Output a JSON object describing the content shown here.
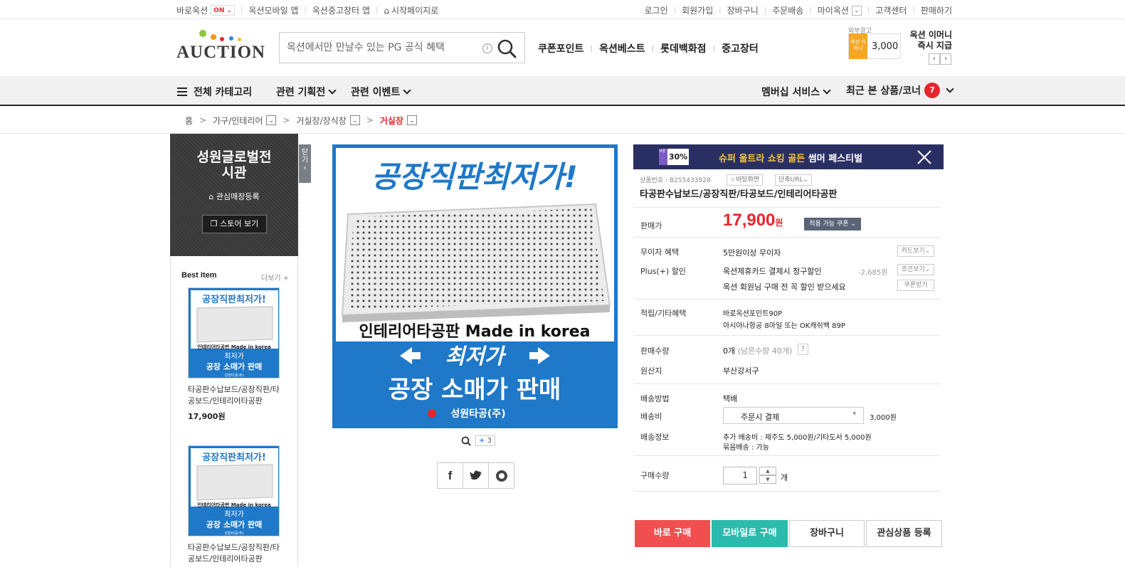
{
  "topbar": {
    "baro_label": "바로옥션",
    "baro_state": "ON",
    "links_left": [
      "옥션모바일 앱",
      "옥션중고장터 앱",
      "시작페이지로"
    ],
    "links_right": [
      "로그인",
      "회원가입",
      "장바구니",
      "주문배송",
      "마이옥션",
      "고객센터",
      "판매하기"
    ]
  },
  "header": {
    "logo_text": "AUCTION",
    "search_placeholder": "옥션에서만 만날수 있는 PG 공식 혜택",
    "quick_links": [
      "쿠폰포인트",
      "옥션베스트",
      "롯데백화점",
      "중고장터"
    ],
    "promo_label": "외부광고",
    "promo_badge": "옥션 이머니",
    "promo_amount": "3,000",
    "promo_title_1": "옥션 이머니",
    "promo_title_2": "즉시 지급"
  },
  "nav": {
    "all_categories": "전체 카테고리",
    "related_plans": "관련 기획전",
    "related_events": "관련 이벤트",
    "membership": "멤버십 서비스",
    "recent": "최근 본 상품/코너",
    "recent_count": "7"
  },
  "breadcrumb": [
    "홈",
    "가구/인테리어",
    "거실장/장식장",
    "거실장"
  ],
  "store": {
    "name_1": "성원글로벌전",
    "name_2": "시관",
    "fav": "관심매장등록",
    "view_btn": "스토어 보기",
    "close_tab": "닫기",
    "best_title": "Best Item",
    "best_more": "더보기",
    "items": [
      {
        "name_1": "타공판수납보드/공장직판/타",
        "name_2": "공보드/인테리어타공판",
        "price": "17,900원"
      },
      {
        "name_1": "타공판수납보드/공장직판/타",
        "name_2": "공보드/인테리어타공판",
        "price": ""
      }
    ]
  },
  "ad_image": {
    "headline": "공장직판최저가!",
    "product_line": "인테리어타공판 Made in korea",
    "lowest": "최저가",
    "retail": "공장 소매가 판매",
    "brand": "성원타공(주)"
  },
  "gallery": {
    "more_count": "3"
  },
  "event": {
    "badge": "쿠폰",
    "pct": "30%",
    "title_a": "슈퍼 울트라 쇼킹 골든",
    "title_b": "썸머 페스티벌"
  },
  "product": {
    "number": "상품번호 : B255433928",
    "wallpaper_btn": "바탕화면",
    "url_btn": "단축URL",
    "title": "타공판수납보드/공장직판/타공보드/인테리어타공판",
    "price_label": "판매가",
    "price": "17,900",
    "price_unit": "원",
    "coupon_btn": "적용 가능 쿠폰",
    "interest_label": "무이자 혜택",
    "interest_val": "5만원이상 무이자",
    "card_btn": "카드보기",
    "plus_label": "Plus(+) 할인",
    "plus_val": "옥션제휴카드 결제시 청구할인",
    "plus_amount": "-2,685원",
    "condition_btn": "조건보기",
    "member_val": "옥션 회원님 구매 전 꼭 할인 받으세요",
    "coupon_get_btn": "쿠폰받기",
    "reward_label": "적립/기타혜택",
    "reward_1": "바로옥션포인트90P",
    "reward_2": "아시아나항공 8마일 또는 OK캐쉬백 89P",
    "sales_label": "판매수량",
    "sales_val": "0개",
    "sales_remain": "(남은수량 40개)",
    "origin_label": "원산지",
    "origin_val": "부산강서구",
    "ship_method_label": "배송방법",
    "ship_method_val": "택배",
    "ship_fee_label": "배송비",
    "ship_fee_select": "주문시 결제",
    "ship_fee_val": "3,000원",
    "ship_info_label": "배송정보",
    "ship_info_1": "추가 배송비 : 제주도 5,000원/기타도서 5,000원",
    "ship_info_2": "묶음배송 : 가능",
    "qty_label": "구매수량",
    "qty_val": "1",
    "qty_unit": "개"
  },
  "actions": {
    "buy_now": "바로 구매",
    "buy_mobile": "모바일로 구매",
    "cart": "장바구니",
    "wishlist": "관심상품 등록"
  },
  "colors": {
    "accent_red": "#e5262c",
    "buy_red": "#f14f4f",
    "mobile_teal": "#2bbbad",
    "event_navy": "#2a2f63",
    "ad_blue": "#1f78c8"
  }
}
